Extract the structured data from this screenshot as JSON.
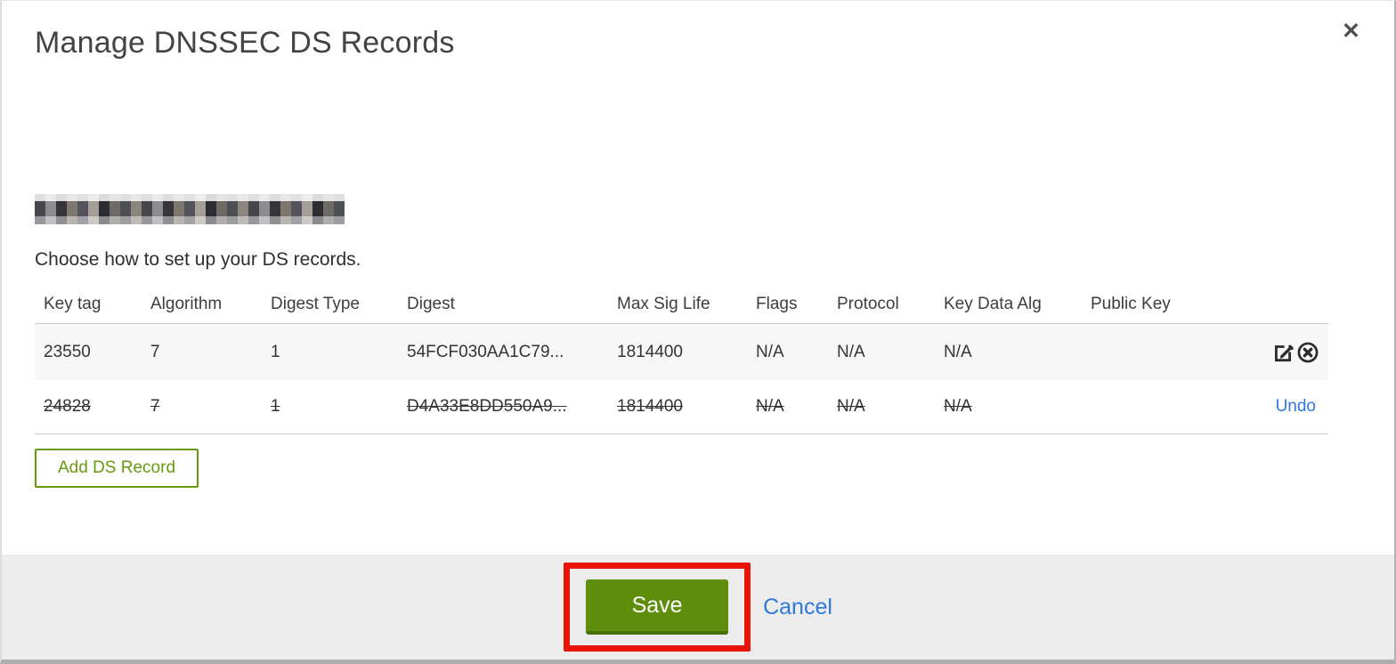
{
  "modal": {
    "title": "Manage DNSSEC DS Records",
    "close_glyph": "✕",
    "intro": "Choose how to set up your DS records.",
    "table": {
      "headers": [
        "Key tag",
        "Algorithm",
        "Digest Type",
        "Digest",
        "Max Sig Life",
        "Flags",
        "Protocol",
        "Key Data Alg",
        "Public Key"
      ],
      "rows": [
        {
          "key_tag": "23550",
          "algorithm": "7",
          "digest_type": "1",
          "digest": "54FCF030AA1C79...",
          "max_sig_life": "1814400",
          "flags": "N/A",
          "protocol": "N/A",
          "key_data_alg": "N/A",
          "public_key": "",
          "deleted": false
        },
        {
          "key_tag": "24828",
          "algorithm": "7",
          "digest_type": "1",
          "digest": "D4A33E8DD550A9...",
          "max_sig_life": "1814400",
          "flags": "N/A",
          "protocol": "N/A",
          "key_data_alg": "N/A",
          "public_key": "",
          "deleted": true,
          "undo_label": "Undo"
        }
      ]
    },
    "add_button_label": "Add DS Record",
    "footer": {
      "save_label": "Save",
      "cancel_label": "Cancel"
    },
    "colors": {
      "green_outline": "#679a0b",
      "save_green": "#5f8e0c",
      "link_blue": "#2f79dd",
      "annotation_red": "#e81309",
      "row_stripe": "#f7f7f7",
      "footer_bg": "#ececec"
    }
  }
}
